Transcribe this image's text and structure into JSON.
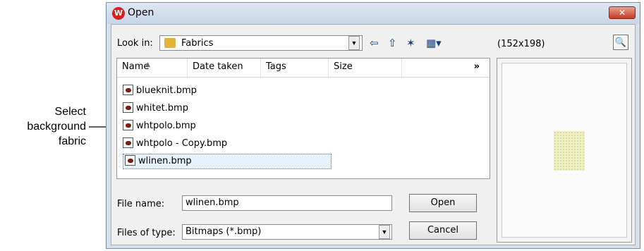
{
  "annotation": {
    "lines": [
      "Select",
      "background",
      "fabric"
    ]
  },
  "window": {
    "title": "Open",
    "app_icon_glyph": "W",
    "close_glyph": "✕"
  },
  "look_in": {
    "label": "Look in:",
    "value": "Fabrics"
  },
  "toolbar": {
    "back_glyph": "⇦",
    "up_glyph": "⇧",
    "new_folder_glyph": "✶",
    "view_glyph": "▦▾"
  },
  "preview": {
    "dimensions": "(152x198)",
    "toggle_glyph": "🔍"
  },
  "file_list": {
    "columns": [
      "Name",
      "Date taken",
      "Tags",
      "Size"
    ],
    "more_glyph": "»",
    "files": [
      {
        "name": "blueknit.bmp"
      },
      {
        "name": "whitet.bmp"
      },
      {
        "name": "whtpolo.bmp"
      },
      {
        "name": "whtpolo - Copy.bmp"
      },
      {
        "name": "wlinen.bmp",
        "selected": true
      }
    ]
  },
  "file_name": {
    "label": "File name:",
    "value": "wlinen.bmp"
  },
  "file_type": {
    "label": "Files of type:",
    "value": "Bitmaps (*.bmp)"
  },
  "buttons": {
    "open": "Open",
    "cancel": "Cancel"
  },
  "colors": {
    "title_bar": "#d6dfea",
    "close_button": "#c53a22",
    "selection": "#e6f2fc"
  }
}
